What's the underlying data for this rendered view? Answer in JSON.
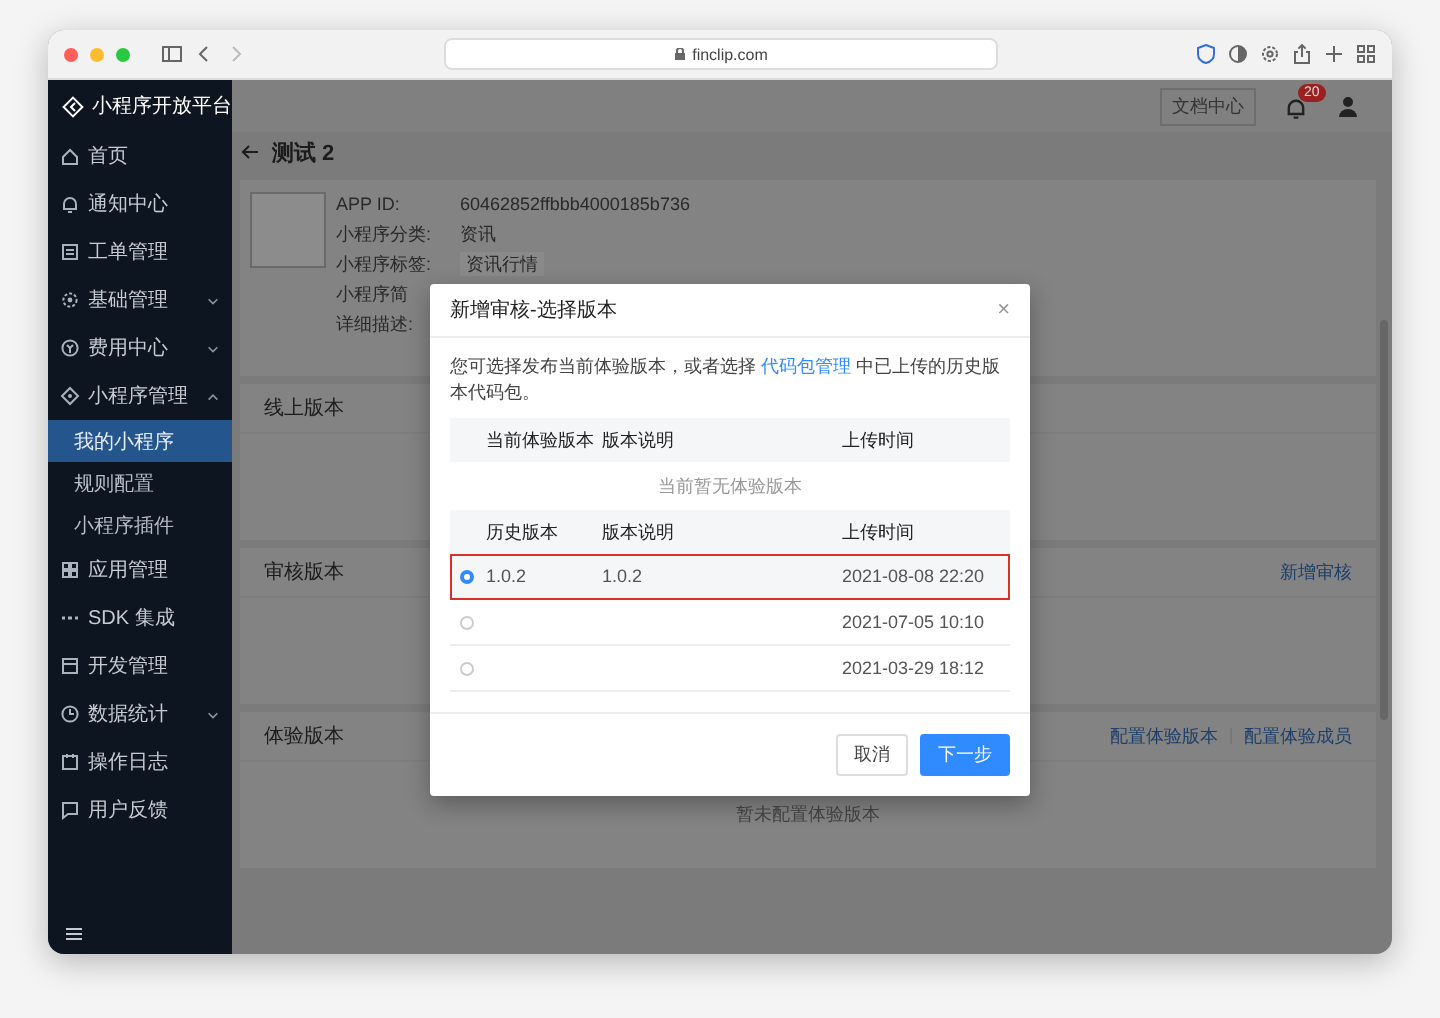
{
  "browser": {
    "url": "finclip.com"
  },
  "header": {
    "logo": "小程序开放平台",
    "docs_button": "文档中心",
    "notification_count": "20"
  },
  "sidebar": {
    "items": [
      {
        "label": "首页"
      },
      {
        "label": "通知中心"
      },
      {
        "label": "工单管理"
      },
      {
        "label": "基础管理",
        "expanded": false
      },
      {
        "label": "费用中心",
        "expanded": false
      },
      {
        "label": "小程序管理",
        "expanded": true,
        "children": [
          {
            "label": "我的小程序",
            "selected": true
          },
          {
            "label": "规则配置",
            "selected": false
          },
          {
            "label": "小程序插件",
            "selected": false
          }
        ]
      },
      {
        "label": "应用管理"
      },
      {
        "label": "SDK 集成"
      },
      {
        "label": "开发管理"
      },
      {
        "label": "数据统计",
        "expanded": false
      },
      {
        "label": "操作日志"
      },
      {
        "label": "用户反馈"
      }
    ]
  },
  "page": {
    "title": "测试 2",
    "info": [
      {
        "label": "APP ID:",
        "value": "60462852ffbbb4000185b736"
      },
      {
        "label": "小程序分类:",
        "value": "资讯"
      },
      {
        "label": "小程序标签:",
        "value": "资讯行情",
        "kind": "tag"
      },
      {
        "label": "小程序简"
      },
      {
        "label": "详细描述:"
      }
    ],
    "sections": [
      {
        "title": "线上版本"
      },
      {
        "title": "审核版本",
        "actions": [
          "新增审核"
        ]
      },
      {
        "title": "体验版本",
        "actions": [
          "配置体验版本",
          "配置体验成员"
        ],
        "empty_text": "暂未配置体验版本"
      }
    ]
  },
  "dialog": {
    "title": "新增审核-选择版本",
    "close": "×",
    "description": {
      "before": "您可选择发布当前体验版本，或者选择 ",
      "link": "代码包管理",
      "after": " 中已上传的历史版本代码包。"
    },
    "current": {
      "columns": [
        "当前体验版本",
        "版本说明",
        "上传时间"
      ],
      "empty_text": "当前暂无体验版本"
    },
    "history": {
      "columns": [
        "历史版本",
        "版本说明",
        "上传时间"
      ],
      "rows": [
        {
          "version": "1.0.2",
          "description": "1.0.2",
          "uploaded": "2021-08-08 22:20",
          "selected": true
        },
        {
          "uploaded": "2021-07-05 10:10",
          "selected": false
        },
        {
          "uploaded": "2021-03-29 18:12",
          "selected": false
        }
      ]
    },
    "buttons": [
      {
        "label": "取消",
        "kind": "default"
      },
      {
        "label": "下一步",
        "kind": "primary"
      }
    ]
  }
}
